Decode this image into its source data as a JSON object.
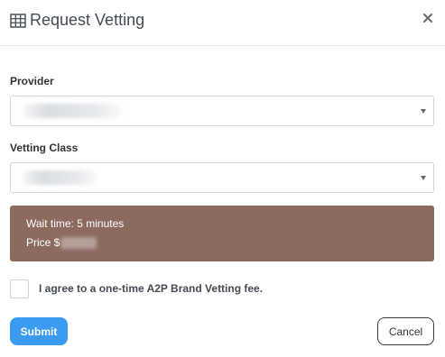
{
  "header": {
    "title": "Request Vetting",
    "title_icon": "table-grid-icon",
    "close_icon": "close-icon"
  },
  "form": {
    "provider": {
      "label": "Provider",
      "selected_value": ""
    },
    "vetting_class": {
      "label": "Vetting Class",
      "selected_value": ""
    },
    "info": {
      "wait_time": "Wait time: 5 minutes",
      "price_prefix": "Price $"
    },
    "agree": {
      "checked": false,
      "label": "I agree to a one-time A2P Brand Vetting fee."
    }
  },
  "footer": {
    "submit_label": "Submit",
    "cancel_label": "Cancel"
  },
  "colors": {
    "info_background": "#8c6a5f",
    "submit_background": "#3b9bf0",
    "title_text": "#444b53"
  }
}
